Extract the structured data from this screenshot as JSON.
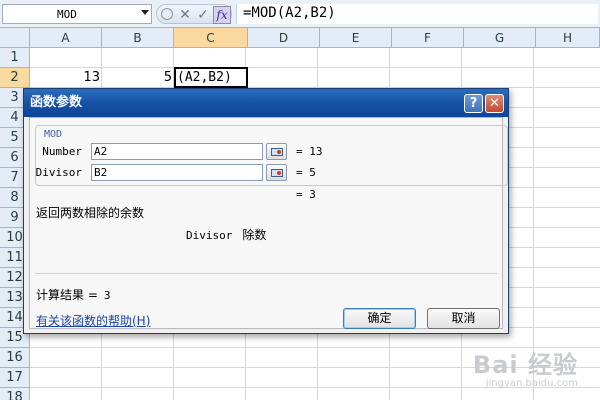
{
  "formula_bar": {
    "name_box": "MOD",
    "cancel_symbol": "✕",
    "enter_symbol": "✓",
    "fx_label": "fx",
    "formula": "=MOD(A2,B2)"
  },
  "sheet": {
    "columns": [
      "A",
      "B",
      "C",
      "D",
      "E",
      "F",
      "G",
      "H"
    ],
    "selected_column": "C",
    "rows": [
      "1",
      "2",
      "3",
      "4",
      "5",
      "6",
      "7",
      "8",
      "9",
      "10",
      "11",
      "12",
      "13",
      "14",
      "15",
      "16",
      "17",
      "18"
    ],
    "selected_row": "2",
    "cells": {
      "A2": "13",
      "B2": "5",
      "C2": "(A2,B2)"
    }
  },
  "dialog": {
    "title": "函数参数",
    "help_symbol": "?",
    "close_symbol": "✕",
    "group_label": "MOD",
    "args": [
      {
        "label": "Number",
        "value": "A2",
        "result": "= 13"
      },
      {
        "label": "Divisor",
        "value": "B2",
        "result": "= 5"
      }
    ],
    "formula_result": "= 3",
    "description": "返回两数相除的余数",
    "arg_desc_name": "Divisor",
    "arg_desc_text": "除数",
    "calc_label": "计算结果 =",
    "calc_value": "3",
    "help_link": "有关该函数的帮助(H)",
    "ok_label": "确定",
    "cancel_label": "取消"
  },
  "watermark": {
    "brand": "Bai 经验",
    "url": "jingyan.baidu.com"
  }
}
